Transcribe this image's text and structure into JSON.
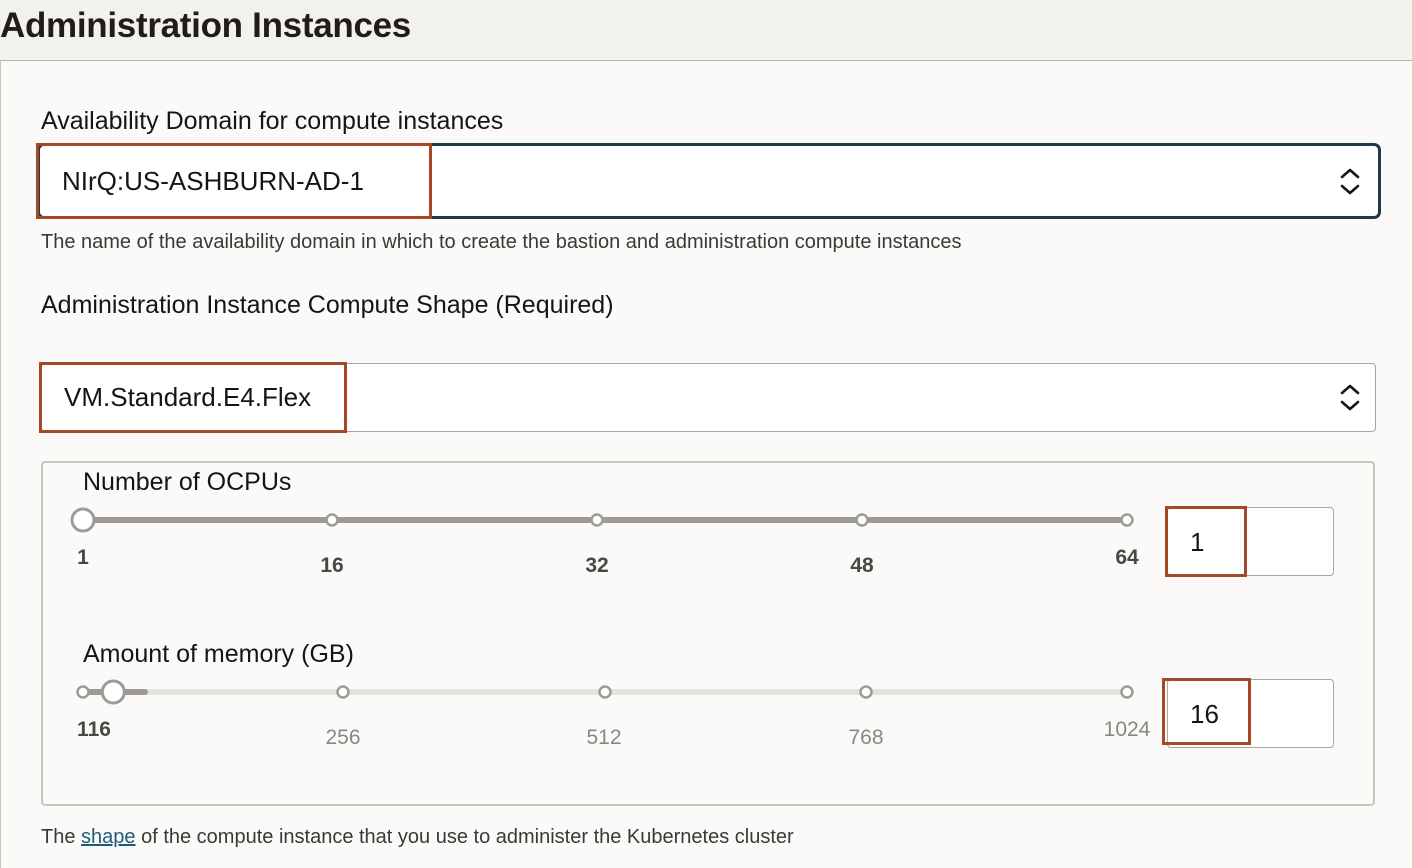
{
  "section": {
    "title": "Administration Instances"
  },
  "availability_domain": {
    "label": "Availability Domain for compute instances",
    "value": "NIrQ:US-ASHBURN-AD-1",
    "help": "The name of the availability domain in which to create the bastion and administration compute instances"
  },
  "compute_shape": {
    "label": "Administration Instance Compute Shape (Required)",
    "value": "VM.Standard.E4.Flex",
    "help_prefix": "The ",
    "help_link": "shape",
    "help_suffix": " of the compute instance that you use to administer the Kubernetes cluster"
  },
  "ocpus": {
    "label": "Number of OCPUs",
    "min": 1,
    "max": 64,
    "value": 1,
    "value_text": "1",
    "ticks": [
      "1",
      "16",
      "32",
      "48",
      "64"
    ]
  },
  "memory": {
    "label": "Amount of memory (GB)",
    "min": 1,
    "max": 1024,
    "value": 16,
    "value_text": "16",
    "ticks": [
      "116",
      "256",
      "512",
      "768",
      "1024"
    ]
  },
  "colors": {
    "highlight": "#a3492a",
    "focus_border": "#1d3a47",
    "link": "#1c5d7a",
    "track_active": "#9e9b97",
    "track_inactive": "#e4e2df"
  },
  "icons": {
    "select_toggle": "chevron-up-down-icon"
  }
}
